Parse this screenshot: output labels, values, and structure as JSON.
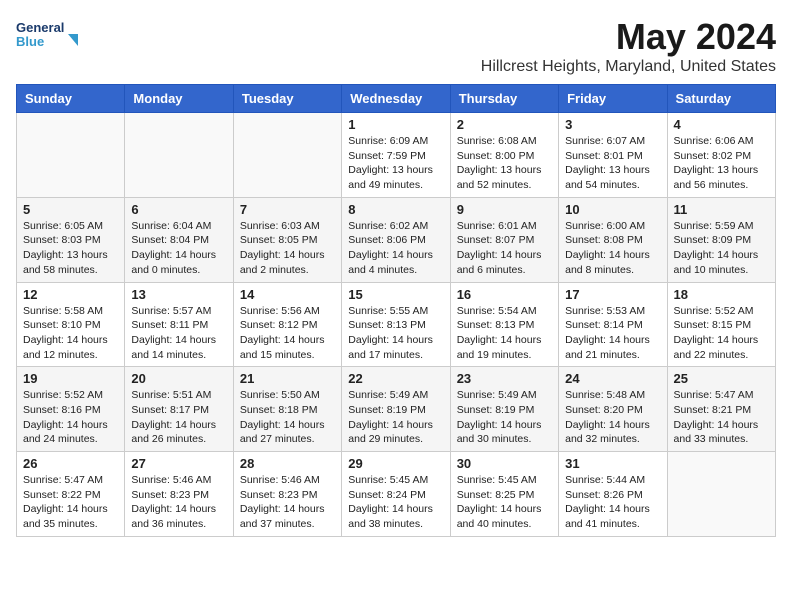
{
  "logo": {
    "line1": "General",
    "line2": "Blue"
  },
  "title": "May 2024",
  "location": "Hillcrest Heights, Maryland, United States",
  "days_of_week": [
    "Sunday",
    "Monday",
    "Tuesday",
    "Wednesday",
    "Thursday",
    "Friday",
    "Saturday"
  ],
  "weeks": [
    [
      {
        "day": "",
        "info": ""
      },
      {
        "day": "",
        "info": ""
      },
      {
        "day": "",
        "info": ""
      },
      {
        "day": "1",
        "info": "Sunrise: 6:09 AM\nSunset: 7:59 PM\nDaylight: 13 hours\nand 49 minutes."
      },
      {
        "day": "2",
        "info": "Sunrise: 6:08 AM\nSunset: 8:00 PM\nDaylight: 13 hours\nand 52 minutes."
      },
      {
        "day": "3",
        "info": "Sunrise: 6:07 AM\nSunset: 8:01 PM\nDaylight: 13 hours\nand 54 minutes."
      },
      {
        "day": "4",
        "info": "Sunrise: 6:06 AM\nSunset: 8:02 PM\nDaylight: 13 hours\nand 56 minutes."
      }
    ],
    [
      {
        "day": "5",
        "info": "Sunrise: 6:05 AM\nSunset: 8:03 PM\nDaylight: 13 hours\nand 58 minutes."
      },
      {
        "day": "6",
        "info": "Sunrise: 6:04 AM\nSunset: 8:04 PM\nDaylight: 14 hours\nand 0 minutes."
      },
      {
        "day": "7",
        "info": "Sunrise: 6:03 AM\nSunset: 8:05 PM\nDaylight: 14 hours\nand 2 minutes."
      },
      {
        "day": "8",
        "info": "Sunrise: 6:02 AM\nSunset: 8:06 PM\nDaylight: 14 hours\nand 4 minutes."
      },
      {
        "day": "9",
        "info": "Sunrise: 6:01 AM\nSunset: 8:07 PM\nDaylight: 14 hours\nand 6 minutes."
      },
      {
        "day": "10",
        "info": "Sunrise: 6:00 AM\nSunset: 8:08 PM\nDaylight: 14 hours\nand 8 minutes."
      },
      {
        "day": "11",
        "info": "Sunrise: 5:59 AM\nSunset: 8:09 PM\nDaylight: 14 hours\nand 10 minutes."
      }
    ],
    [
      {
        "day": "12",
        "info": "Sunrise: 5:58 AM\nSunset: 8:10 PM\nDaylight: 14 hours\nand 12 minutes."
      },
      {
        "day": "13",
        "info": "Sunrise: 5:57 AM\nSunset: 8:11 PM\nDaylight: 14 hours\nand 14 minutes."
      },
      {
        "day": "14",
        "info": "Sunrise: 5:56 AM\nSunset: 8:12 PM\nDaylight: 14 hours\nand 15 minutes."
      },
      {
        "day": "15",
        "info": "Sunrise: 5:55 AM\nSunset: 8:13 PM\nDaylight: 14 hours\nand 17 minutes."
      },
      {
        "day": "16",
        "info": "Sunrise: 5:54 AM\nSunset: 8:13 PM\nDaylight: 14 hours\nand 19 minutes."
      },
      {
        "day": "17",
        "info": "Sunrise: 5:53 AM\nSunset: 8:14 PM\nDaylight: 14 hours\nand 21 minutes."
      },
      {
        "day": "18",
        "info": "Sunrise: 5:52 AM\nSunset: 8:15 PM\nDaylight: 14 hours\nand 22 minutes."
      }
    ],
    [
      {
        "day": "19",
        "info": "Sunrise: 5:52 AM\nSunset: 8:16 PM\nDaylight: 14 hours\nand 24 minutes."
      },
      {
        "day": "20",
        "info": "Sunrise: 5:51 AM\nSunset: 8:17 PM\nDaylight: 14 hours\nand 26 minutes."
      },
      {
        "day": "21",
        "info": "Sunrise: 5:50 AM\nSunset: 8:18 PM\nDaylight: 14 hours\nand 27 minutes."
      },
      {
        "day": "22",
        "info": "Sunrise: 5:49 AM\nSunset: 8:19 PM\nDaylight: 14 hours\nand 29 minutes."
      },
      {
        "day": "23",
        "info": "Sunrise: 5:49 AM\nSunset: 8:19 PM\nDaylight: 14 hours\nand 30 minutes."
      },
      {
        "day": "24",
        "info": "Sunrise: 5:48 AM\nSunset: 8:20 PM\nDaylight: 14 hours\nand 32 minutes."
      },
      {
        "day": "25",
        "info": "Sunrise: 5:47 AM\nSunset: 8:21 PM\nDaylight: 14 hours\nand 33 minutes."
      }
    ],
    [
      {
        "day": "26",
        "info": "Sunrise: 5:47 AM\nSunset: 8:22 PM\nDaylight: 14 hours\nand 35 minutes."
      },
      {
        "day": "27",
        "info": "Sunrise: 5:46 AM\nSunset: 8:23 PM\nDaylight: 14 hours\nand 36 minutes."
      },
      {
        "day": "28",
        "info": "Sunrise: 5:46 AM\nSunset: 8:23 PM\nDaylight: 14 hours\nand 37 minutes."
      },
      {
        "day": "29",
        "info": "Sunrise: 5:45 AM\nSunset: 8:24 PM\nDaylight: 14 hours\nand 38 minutes."
      },
      {
        "day": "30",
        "info": "Sunrise: 5:45 AM\nSunset: 8:25 PM\nDaylight: 14 hours\nand 40 minutes."
      },
      {
        "day": "31",
        "info": "Sunrise: 5:44 AM\nSunset: 8:26 PM\nDaylight: 14 hours\nand 41 minutes."
      },
      {
        "day": "",
        "info": ""
      }
    ]
  ]
}
